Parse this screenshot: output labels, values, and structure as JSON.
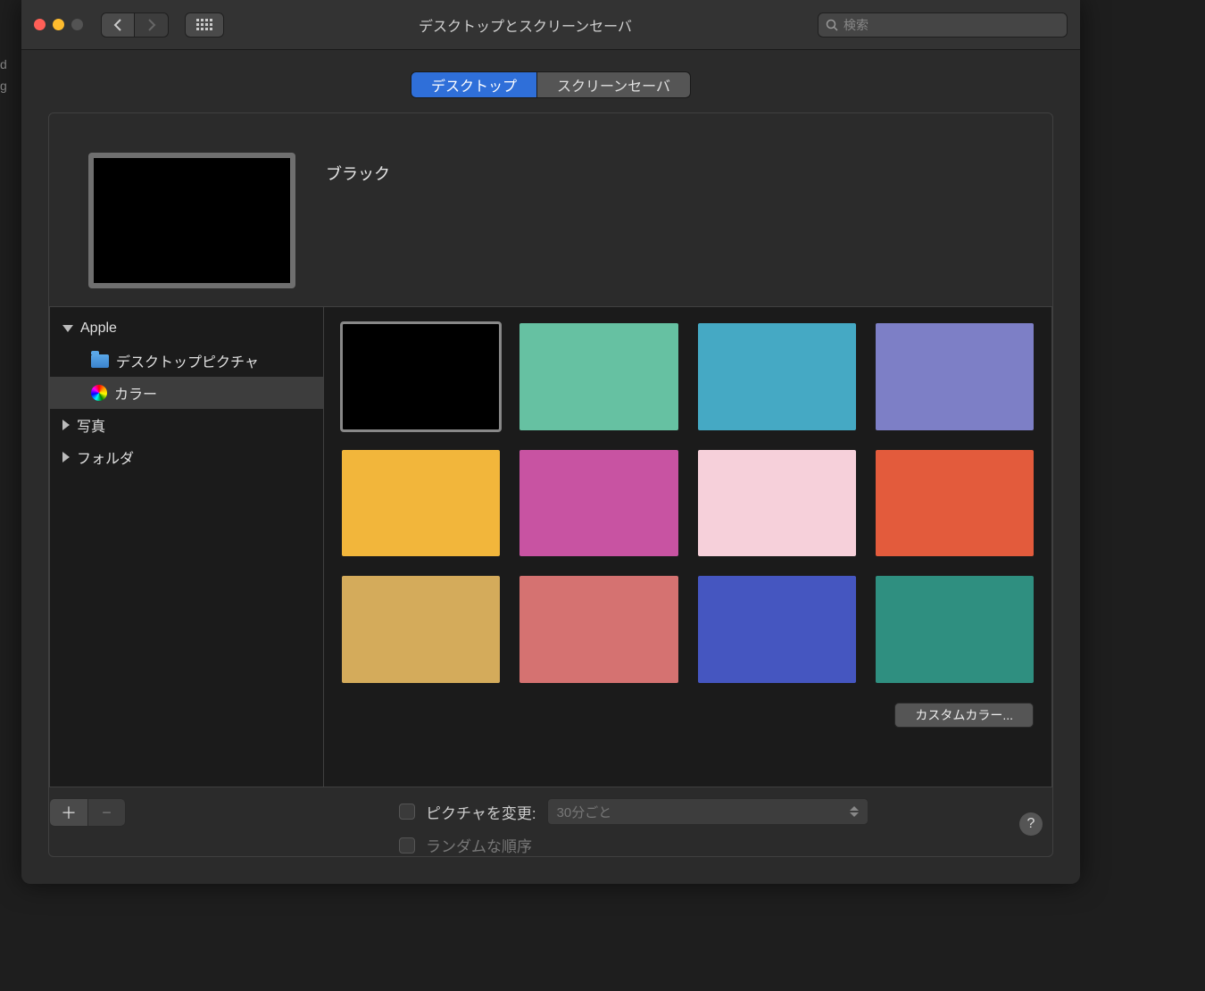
{
  "window": {
    "title": "デスクトップとスクリーンセーバ",
    "search_placeholder": "検索"
  },
  "tabs": [
    {
      "label": "デスクトップ",
      "active": true
    },
    {
      "label": "スクリーンセーバ",
      "active": false
    }
  ],
  "current": {
    "name": "ブラック",
    "swatch": "#000000"
  },
  "sidebar": {
    "groups": [
      {
        "label": "Apple",
        "expanded": true,
        "children": [
          {
            "label": "デスクトップピクチャ",
            "icon": "folder"
          },
          {
            "label": "カラー",
            "icon": "colorwheel",
            "selected": true
          }
        ]
      },
      {
        "label": "写真",
        "expanded": false
      },
      {
        "label": "フォルダ",
        "expanded": false
      }
    ]
  },
  "colors": [
    "#000000",
    "#66c1a2",
    "#45a9c4",
    "#7d7fc6",
    "#f2b63b",
    "#c853a2",
    "#f6d0da",
    "#e35b3c",
    "#d4ab5b",
    "#d57271",
    "#4556c0",
    "#2f8f80"
  ],
  "custom_color_label": "カスタムカラー...",
  "options": {
    "change_picture_label": "ピクチャを変更:",
    "interval_value": "30分ごと",
    "random_label": "ランダムな順序"
  },
  "left_hint": [
    "d",
    "g"
  ]
}
